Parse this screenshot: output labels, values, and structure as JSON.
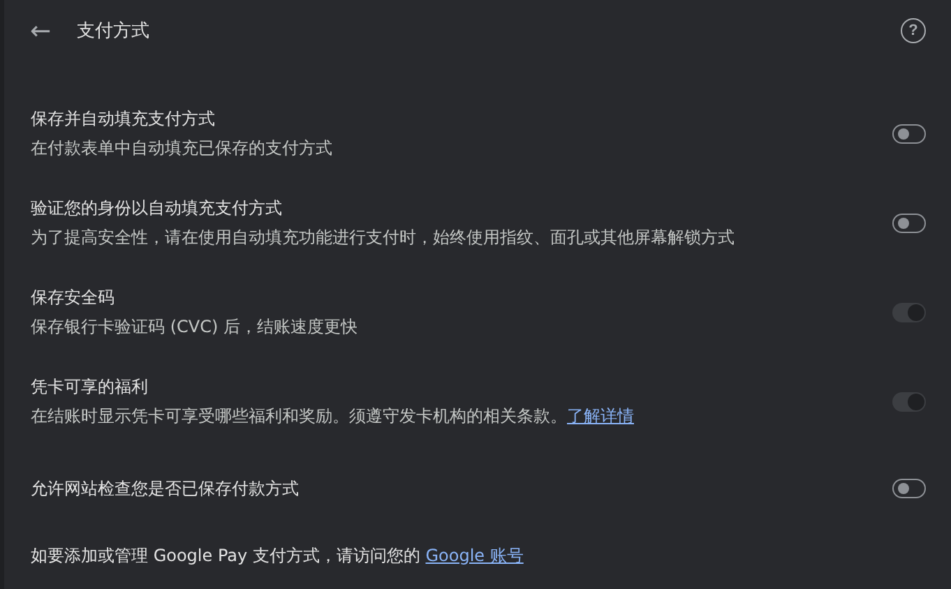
{
  "header": {
    "back": "←",
    "title": "支付方式",
    "help": "?"
  },
  "settings": [
    {
      "title": "保存并自动填充支付方式",
      "description": "在付款表单中自动填充已保存的支付方式",
      "checked": false,
      "disabled": false
    },
    {
      "title": "验证您的身份以自动填充支付方式",
      "description": "为了提高安全性，请在使用自动填充功能进行支付时，始终使用指纹、面孔或其他屏幕解锁方式",
      "checked": false,
      "disabled": false
    },
    {
      "title": "保存安全码",
      "description": "保存银行卡验证码 (CVC) 后，结账速度更快",
      "checked": true,
      "disabled": true
    },
    {
      "title": "凭卡可享的福利",
      "description": "在结账时显示凭卡可享受哪些福利和奖励。须遵守发卡机构的相关条款。",
      "link": "了解详情",
      "checked": true,
      "disabled": true
    },
    {
      "title": "允许网站检查您是否已保存付款方式",
      "checked": false,
      "disabled": false
    }
  ],
  "footer": {
    "text": "如要添加或管理 Google Pay 支付方式，请访问您的",
    "link": "Google 账号"
  }
}
